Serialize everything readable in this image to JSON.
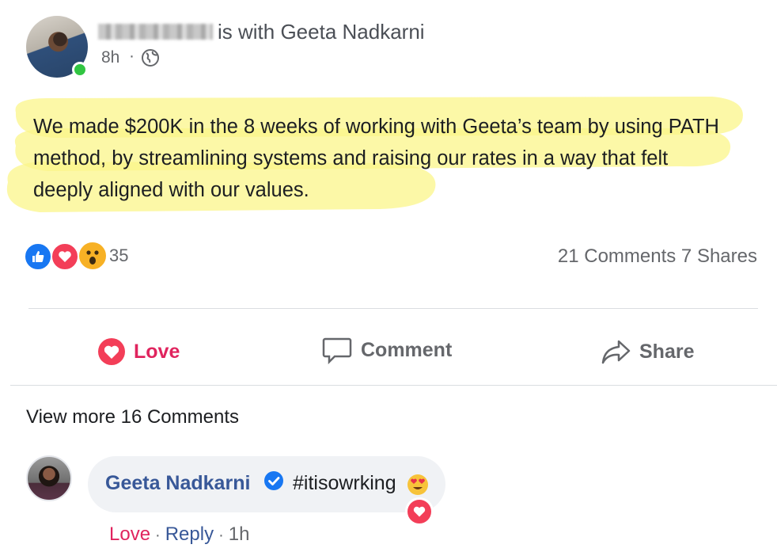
{
  "post": {
    "with_text": "is with Geeta Nadkarni",
    "time": "8h",
    "separator": "·",
    "privacy_icon": "globe-icon",
    "body": "We made $200K in the 8 weeks of working with Geeta’s team by using PATH method, by streamlining systems and raising our rates in a way that felt deeply aligned with our values."
  },
  "reactions": {
    "icons": [
      "like-icon",
      "love-icon",
      "wow-icon"
    ],
    "count": "35",
    "comments_shares": "21 Comments 7 Shares"
  },
  "actions": {
    "love_label": "Love",
    "comment_label": "Comment",
    "share_label": "Share"
  },
  "comments": {
    "view_more": "View more 16 Comments",
    "items": [
      {
        "author": "Geeta Nadkarni",
        "text": "#itisowrking",
        "emoji": "heart-eyes-emoji",
        "reaction": "love-icon",
        "love_label": "Love",
        "sep": "·",
        "reply_label": "Reply",
        "time": "1h"
      }
    ]
  },
  "colors": {
    "love": "#e0245e",
    "link_blue": "#385898",
    "highlight": "#fbf58a",
    "online": "#31c542"
  }
}
